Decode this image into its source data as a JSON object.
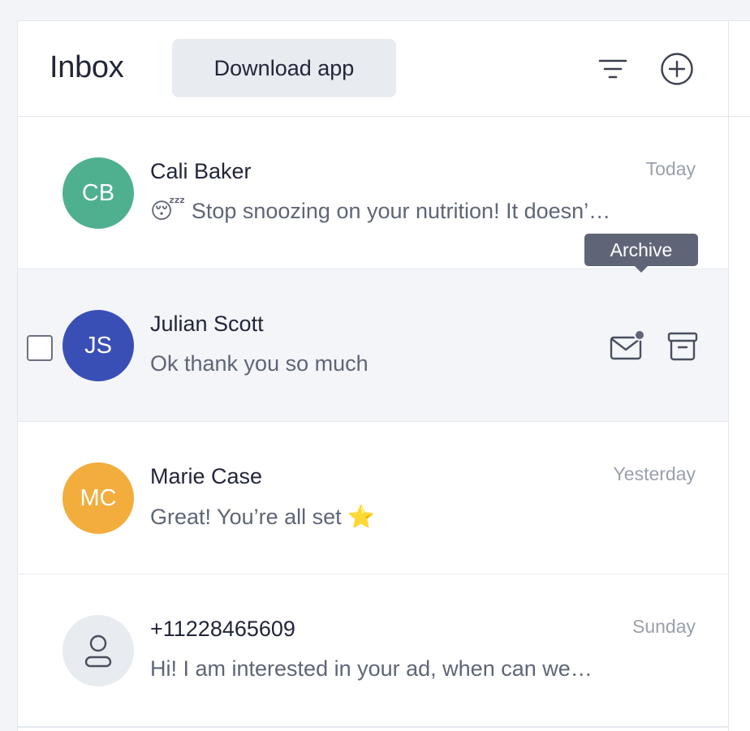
{
  "header": {
    "title": "Inbox",
    "download_label": "Download app",
    "filter_icon": "filter-icon",
    "add_icon": "plus-circle-icon"
  },
  "tooltip": {
    "text": "Archive"
  },
  "conversations": [
    {
      "initials": "CB",
      "name": "Cali Baker",
      "emoji": "😴",
      "preview": "Stop snoozing on your nutrition! It doesn’…",
      "time": "Today",
      "avatar_color": "#4fb08f"
    },
    {
      "initials": "JS",
      "name": "Julian Scott",
      "preview": "Ok thank you so much",
      "avatar_color": "#3a4fb5",
      "actions": {
        "mark_unread_icon": "mail-unread-icon",
        "archive_icon": "archive-icon"
      }
    },
    {
      "initials": "MC",
      "name": "Marie Case",
      "preview": "Great! You’re all set",
      "emoji": "⭐",
      "time": "Yesterday",
      "avatar_color": "#f2ad3c"
    },
    {
      "name": "+11228465609",
      "preview": "Hi! I am interested in your ad, when can we…",
      "time": "Sunday",
      "avatar_icon": "user-icon",
      "avatar_color": "#e8ebef"
    }
  ]
}
